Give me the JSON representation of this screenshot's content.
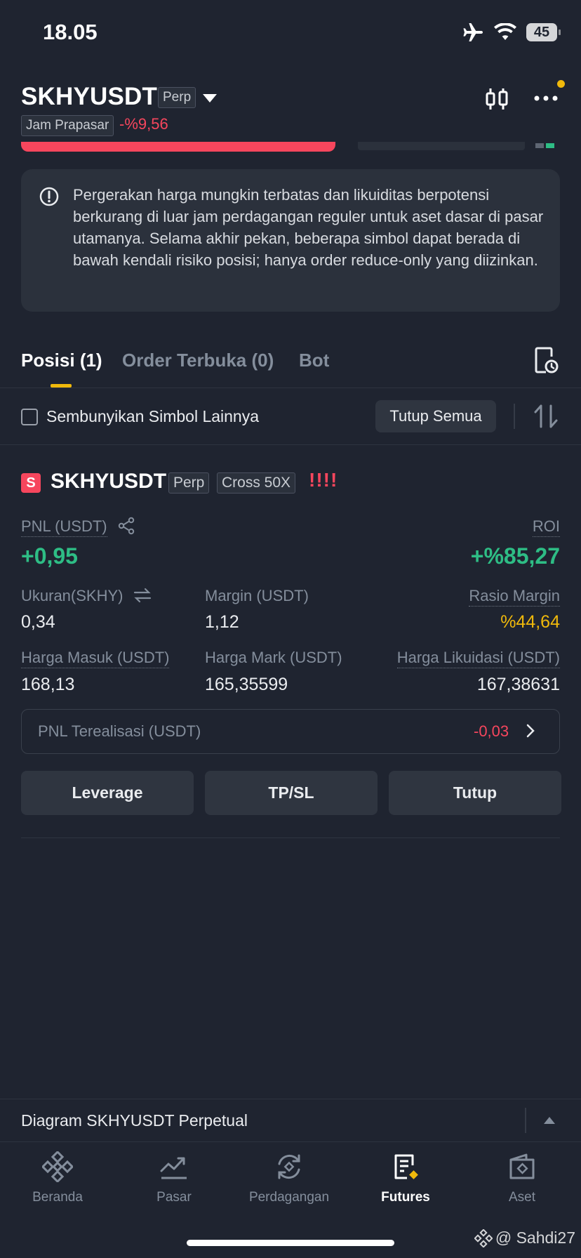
{
  "status_bar": {
    "time": "18.05",
    "battery": "45"
  },
  "header": {
    "symbol": "SKHYUSDT",
    "contract_type": "Perp",
    "session_tag": "Jam Prapasar",
    "change_percent": "-%9,56"
  },
  "notice": {
    "text": "Pergerakan harga mungkin terbatas dan likuiditas berpotensi berkurang di luar jam perdagangan reguler untuk aset dasar di pasar utamanya. Selama akhir pekan, beberapa simbol dapat berada di bawah kendali risiko posisi; hanya order reduce-only yang diizinkan."
  },
  "tabs": [
    {
      "label": "Posisi (1)",
      "active": true
    },
    {
      "label": "Order Terbuka (0)",
      "active": false
    },
    {
      "label": "Bot",
      "active": false
    }
  ],
  "filter": {
    "hide_label": "Sembunyikan Simbol Lainnya",
    "close_all_label": "Tutup Semua"
  },
  "position": {
    "side_badge": "S",
    "symbol": "SKHYUSDT",
    "contract_type": "Perp",
    "margin_mode": "Cross 50X",
    "risk_indicator": "!!!!",
    "pnl_label": "PNL (USDT)",
    "pnl_value": "+0,95",
    "roi_label": "ROI",
    "roi_value": "+%85,27",
    "size_label": "Ukuran(SKHY)",
    "size_value": "0,34",
    "margin_label": "Margin (USDT)",
    "margin_value": "1,12",
    "margin_ratio_label": "Rasio Margin",
    "margin_ratio_value": "%44,64",
    "entry_label": "Harga Masuk (USDT)",
    "entry_value": "168,13",
    "mark_label": "Harga Mark (USDT)",
    "mark_value": "165,35599",
    "liq_label": "Harga Likuidasi (USDT)",
    "liq_value": "167,38631",
    "realized_label": "PNL Terealisasi (USDT)",
    "realized_value": "-0,03",
    "buttons": {
      "leverage": "Leverage",
      "tpsl": "TP/SL",
      "close": "Tutup"
    }
  },
  "chart_bar": {
    "label": "Diagram SKHYUSDT Perpetual"
  },
  "nav": [
    {
      "label": "Beranda",
      "icon": "binance-logo-icon",
      "active": false
    },
    {
      "label": "Pasar",
      "icon": "market-trend-icon",
      "active": false
    },
    {
      "label": "Perdagangan",
      "icon": "trade-swap-icon",
      "active": false
    },
    {
      "label": "Futures",
      "icon": "futures-document-icon",
      "active": true
    },
    {
      "label": "Aset",
      "icon": "wallet-icon",
      "active": false
    }
  ],
  "watermark": "@ Sahdi27",
  "colors": {
    "background": "#1f2430",
    "green": "#2ebd85",
    "red": "#f6465d",
    "yellow": "#f0b90b",
    "muted": "#848e9c"
  }
}
